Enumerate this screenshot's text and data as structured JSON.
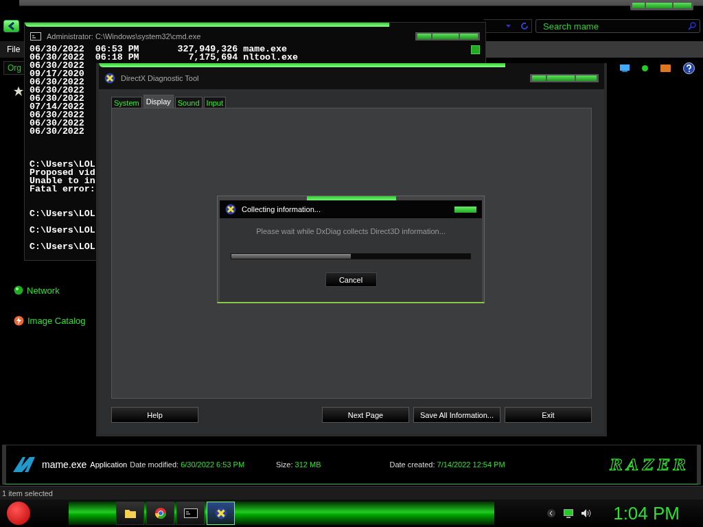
{
  "explorer": {
    "search": {
      "placeholder": "Search mame"
    },
    "menu": [
      {
        "label": "File"
      }
    ],
    "toolbar": {
      "organize": "Org"
    },
    "sidebar": {
      "items": [
        {
          "label": "Network",
          "kind": "network"
        },
        {
          "label": "Image Catalog",
          "kind": "catalog"
        }
      ]
    },
    "details": {
      "name": "mame.exe",
      "type": "Application",
      "logo": "RAZER",
      "fields": [
        {
          "label": "Date modified:",
          "value": "6/30/2022 6:53 PM"
        },
        {
          "label": "Size:",
          "value": "312 MB"
        },
        {
          "label": "Date created:",
          "value": "7/14/2022 12:54 PM"
        }
      ]
    },
    "status_bar": "1 item selected"
  },
  "cmd": {
    "title": "Administrator: C:\\Windows\\system32\\cmd.exe",
    "blocks": [
      [
        "06/30/2022  06:53 PM       327,949,326 mame.exe",
        "06/30/2022  06:18 PM         7,175,694 nltool.exe",
        "06/30/2022",
        "09/17/2020",
        "06/30/2022",
        "06/30/2022",
        "06/30/2022",
        "07/14/2022",
        "06/30/2022",
        "06/30/2022",
        "06/30/2022"
      ],
      [
        "C:\\Users\\LOL",
        "Proposed vid",
        "Unable to in",
        "Fatal error:"
      ],
      [
        "C:\\Users\\LOL"
      ],
      [
        "C:\\Users\\LOL"
      ],
      [
        "C:\\Users\\LOL"
      ]
    ]
  },
  "dxdiag": {
    "title": "DirectX Diagnostic Tool",
    "tabs": [
      {
        "label": "System",
        "selected": false
      },
      {
        "label": "Display",
        "selected": true
      },
      {
        "label": "Sound",
        "selected": false
      },
      {
        "label": "Input",
        "selected": false
      }
    ],
    "buttons": [
      {
        "label": "Help",
        "kind": "left"
      },
      {
        "label": "Next Page",
        "kind": "right"
      },
      {
        "label": "Save All Information...",
        "kind": "right"
      },
      {
        "label": "Exit",
        "kind": "right"
      }
    ]
  },
  "progress_dialog": {
    "title": "Collecting information...",
    "message": "Please wait while DxDiag collects Direct3D information...",
    "level": 0.5,
    "button": "Cancel"
  },
  "taskbar": {
    "apps": [
      {
        "kind": "folder",
        "selected": false
      },
      {
        "kind": "browser",
        "selected": false
      },
      {
        "kind": "terminal",
        "selected": false
      },
      {
        "kind": "dxdiag",
        "selected": true
      }
    ],
    "clock": "1:04 PM"
  }
}
